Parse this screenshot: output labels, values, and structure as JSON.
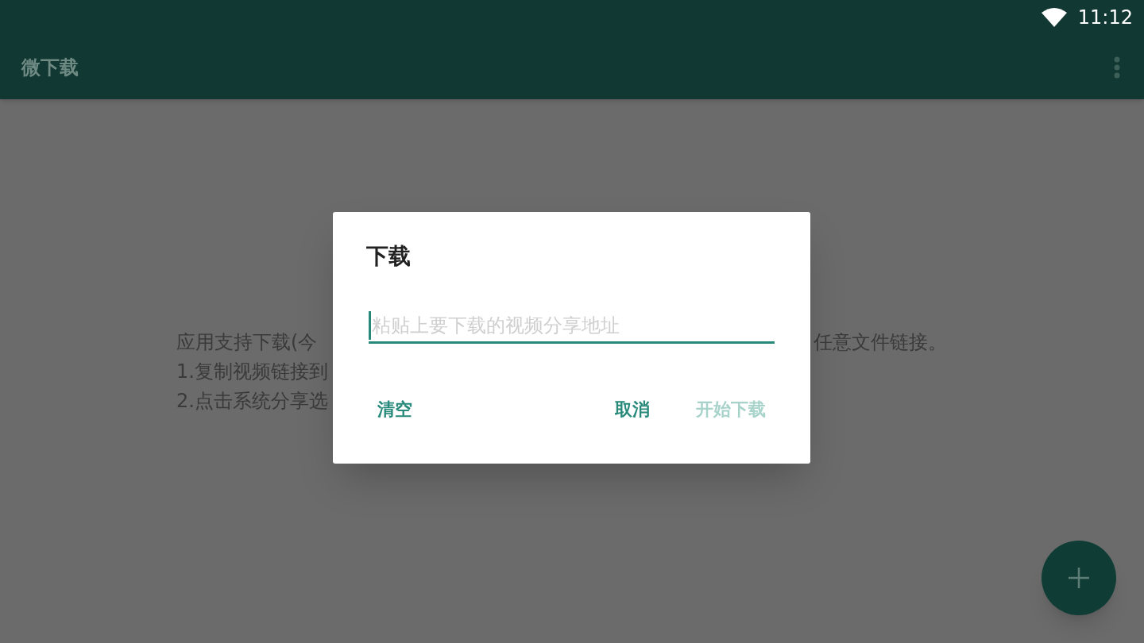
{
  "status_bar": {
    "time": "11:12"
  },
  "app_bar": {
    "title": "微下载"
  },
  "content": {
    "left_fragments": [
      "应用支持下载(今",
      "1.复制视频链接到",
      "2.点击系统分享选"
    ],
    "right_fragments": [
      "任意文件链接。"
    ]
  },
  "dialog": {
    "title": "下载",
    "input": {
      "placeholder": "粘贴上要下载的视频分享地址"
    },
    "buttons": [
      {
        "label": "清空",
        "disabled": false
      },
      {
        "label": "取消",
        "disabled": false
      },
      {
        "label": "开始下载",
        "disabled": true
      }
    ]
  }
}
